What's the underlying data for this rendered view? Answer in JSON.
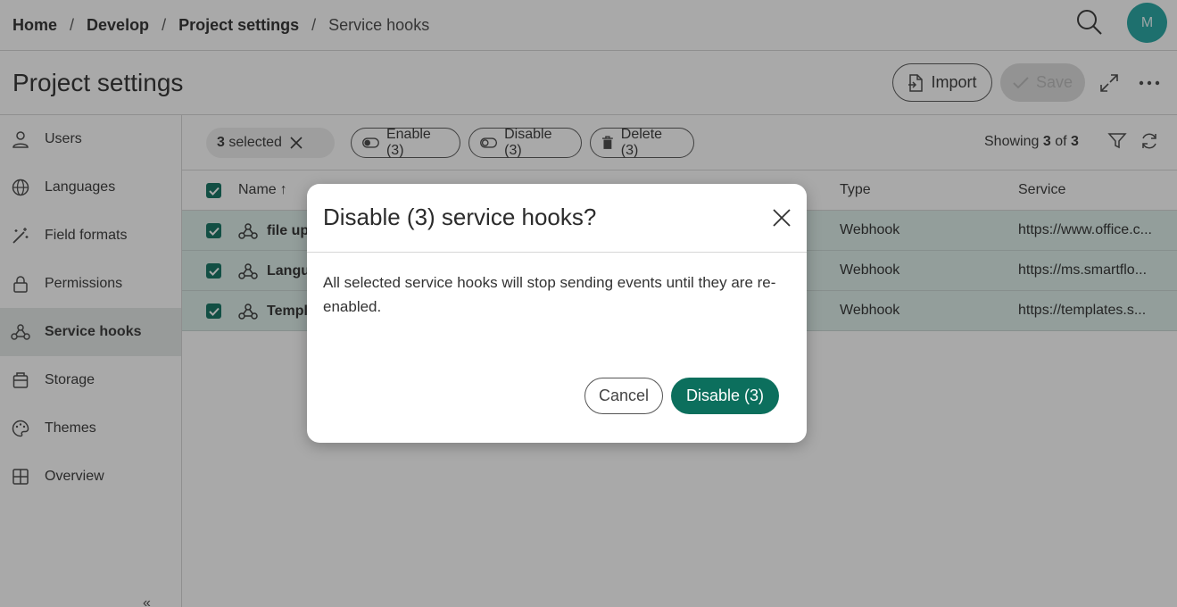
{
  "breadcrumb": {
    "items": [
      {
        "label": "Home"
      },
      {
        "label": "Develop"
      },
      {
        "label": "Project settings"
      },
      {
        "label": "Service hooks"
      }
    ],
    "separator": "/"
  },
  "user": {
    "avatar_initial": "M",
    "avatar_color": "#1fa3a0"
  },
  "header": {
    "title": "Project settings",
    "import_label": "Import",
    "save_label": "Save"
  },
  "sidebar": {
    "items": [
      {
        "label": "Users",
        "icon": "user-icon"
      },
      {
        "label": "Languages",
        "icon": "globe-icon"
      },
      {
        "label": "Field formats",
        "icon": "magic-wand-icon"
      },
      {
        "label": "Permissions",
        "icon": "lock-icon"
      },
      {
        "label": "Service hooks",
        "icon": "webhook-icon",
        "active": true
      },
      {
        "label": "Storage",
        "icon": "storage-icon"
      },
      {
        "label": "Themes",
        "icon": "palette-icon"
      },
      {
        "label": "Overview",
        "icon": "grid-icon"
      }
    ],
    "collapse_glyph": "«"
  },
  "toolbar": {
    "selected_count": "3",
    "selected_label": "selected",
    "enable_label": "Enable (3)",
    "disable_label": "Disable (3)",
    "delete_label": "Delete (3)",
    "showing_prefix": "Showing",
    "showing_count": "3",
    "showing_of": "of",
    "showing_total": "3"
  },
  "table": {
    "columns": {
      "name": "Name",
      "sort_glyph": "↑",
      "type": "Type",
      "service": "Service"
    },
    "rows": [
      {
        "name": "file up",
        "type": "Webhook",
        "service": "https://www.office.c..."
      },
      {
        "name": "Langu",
        "type": "Webhook",
        "service": "https://ms.smartflo..."
      },
      {
        "name": "Templ",
        "type": "Webhook",
        "service": "https://templates.s..."
      }
    ]
  },
  "dialog": {
    "title": "Disable (3) service hooks?",
    "body": "All selected service hooks will stop sending events until they are re-enabled.",
    "cancel_label": "Cancel",
    "confirm_label": "Disable (3)"
  },
  "colors": {
    "accent": "#0c6f5d",
    "row_selected": "#dbeee9"
  }
}
